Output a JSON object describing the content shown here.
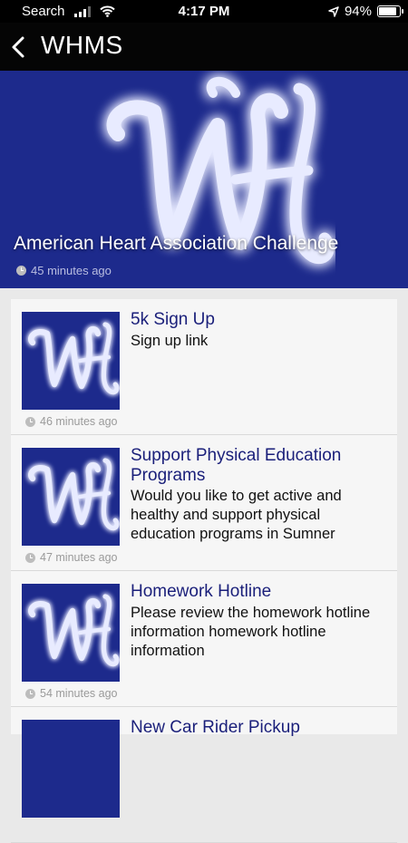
{
  "status_bar": {
    "carrier": "Search",
    "time": "4:17 PM",
    "battery": "94%",
    "battery_level": 0.94,
    "icons": [
      "signal-icon",
      "wifi-icon",
      "location-arrow-icon",
      "battery-icon"
    ]
  },
  "nav": {
    "title": "WHMS",
    "back_icon": "chevron-left-icon"
  },
  "hero": {
    "title": "American Heart Association Challenge",
    "time": "45 minutes ago",
    "background_color": "#1d2a8c"
  },
  "feed": [
    {
      "title": "5k Sign Up",
      "desc": "Sign up link",
      "time": "46 minutes ago"
    },
    {
      "title": "Support Physical Education Programs",
      "desc": "Would you like to get active and healthy and support physical education programs in Sumner",
      "time": "47 minutes ago"
    },
    {
      "title": "Homework Hotline",
      "desc": "Please review the homework hotline information homework hotline information",
      "time": "54 minutes ago"
    },
    {
      "title": "New Car Rider Pickup",
      "desc": "",
      "time": ""
    }
  ],
  "colors": {
    "accent_title": "#1a1f7a",
    "navy": "#1d2a8c",
    "meta_gray": "#9a9a9a"
  }
}
